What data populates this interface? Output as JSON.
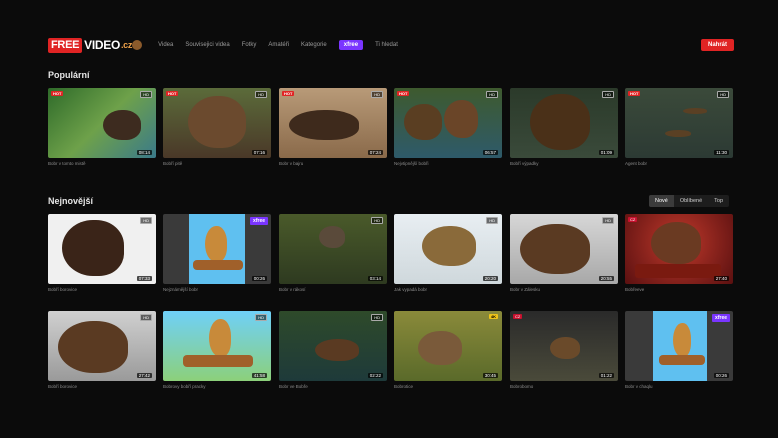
{
  "header": {
    "logo_free": "FREE",
    "logo_video": "VIDEO",
    "logo_cz": ".cz",
    "nav": [
      "Videa",
      "Souvisejici videa",
      "Fotky",
      "Amatéři",
      "Kategorie"
    ],
    "xfree": "xfree",
    "nav_after": "Ti hledat",
    "login": "Nahrát"
  },
  "popular": {
    "title": "Populární",
    "cards": [
      {
        "caption": "Bobr v tomto mistě",
        "duration": "08:14",
        "hot": "HOT",
        "quality": "HD"
      },
      {
        "caption": "Bobří pitě",
        "duration": "07:16",
        "hot": "HOT",
        "quality": "HD"
      },
      {
        "caption": "Bobr v bajru",
        "duration": "07:24",
        "hot": "HOT",
        "quality": "HD"
      },
      {
        "caption": "Nejvtipnější bobři",
        "duration": "06:57",
        "hot": "HOT",
        "quality": "HD"
      },
      {
        "caption": "Bobří výpadky",
        "duration": "01:09",
        "hot": "",
        "quality": "HD"
      },
      {
        "caption": "Agent bobr",
        "duration": "11:30",
        "hot": "HOT",
        "quality": "HD"
      }
    ]
  },
  "newest": {
    "title": "Nejnovější",
    "tabs": [
      "Nové",
      "Oblíbené",
      "Top"
    ],
    "row1": [
      {
        "caption": "Bobří borovice",
        "duration": "07:33",
        "badge": "HD"
      },
      {
        "caption": "Nejznámější bobr",
        "duration": "00:26",
        "badge": "xfree"
      },
      {
        "caption": "Bobr v rákosí",
        "duration": "03:14",
        "badge": "HD"
      },
      {
        "caption": "Jak vypadá bobr",
        "duration": "20:20",
        "badge": "HD"
      },
      {
        "caption": "Bobr v Zálesku",
        "duration": "20:55",
        "badge": "HD"
      },
      {
        "caption": "Bobřeeve",
        "duration": "27:40",
        "badge": "CZ"
      }
    ],
    "row2": [
      {
        "caption": "Bobří borovice",
        "duration": "27:42",
        "badge": "HD"
      },
      {
        "caption": "Bobrovy bobří pracky",
        "duration": "41:58",
        "badge": "HD"
      },
      {
        "caption": "Bobr ve Bobře",
        "duration": "02:22",
        "badge": "HD"
      },
      {
        "caption": "Bobrotice",
        "duration": "30:45",
        "badge": "4K"
      },
      {
        "caption": "Bobrobomo",
        "duration": "01:22",
        "badge": "CZ"
      },
      {
        "caption": "Bobr v chaqlu",
        "duration": "00:26",
        "badge": "xfree"
      }
    ]
  }
}
